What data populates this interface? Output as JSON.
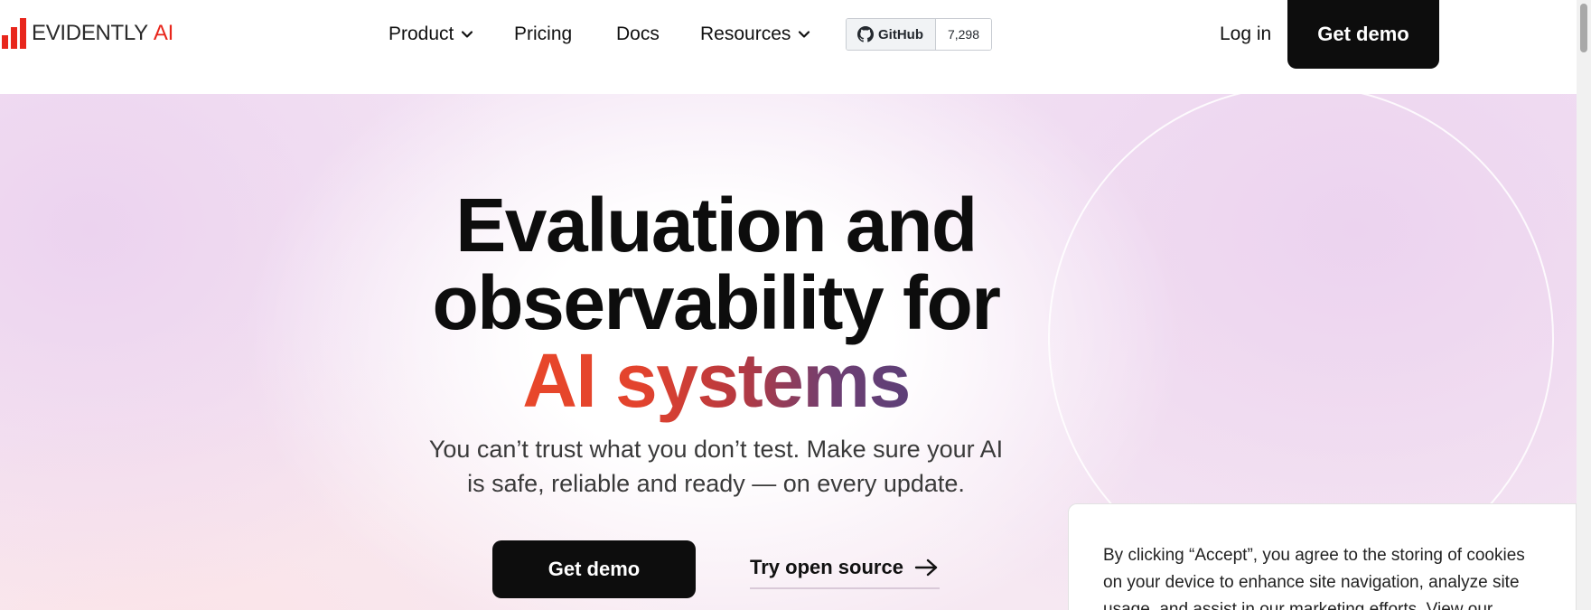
{
  "brand": {
    "name": "EVIDENTLY",
    "suffix": "AI",
    "accent": "#e8261c"
  },
  "nav": {
    "items": [
      {
        "label": "Product",
        "has_dropdown": true
      },
      {
        "label": "Pricing",
        "has_dropdown": false
      },
      {
        "label": "Docs",
        "has_dropdown": false
      },
      {
        "label": "Resources",
        "has_dropdown": true
      }
    ],
    "github": {
      "label": "GitHub",
      "stars": "7,298",
      "icon": "github-icon"
    },
    "login": "Log in",
    "cta": "Get demo"
  },
  "hero": {
    "line1": "Evaluation and",
    "line2": "observability for",
    "line3": "AI systems",
    "subtitle_line1": "You can’t trust what you don’t test. Make sure your AI",
    "subtitle_line2": "is safe, reliable and ready — on every update.",
    "primary_cta": "Get demo",
    "secondary_cta": "Try open source",
    "secondary_icon": "arrow-right-icon"
  },
  "cookie_banner": {
    "line1": "By clicking “Accept”, you agree to the storing of cookies",
    "line2": "on your device to enhance site navigation, analyze site",
    "line3": "usage, and assist in our marketing efforts. View our"
  },
  "colors": {
    "cta_bg": "#0d0d0d",
    "gradient_start": "#e8472a",
    "gradient_end": "#5d3f78"
  }
}
